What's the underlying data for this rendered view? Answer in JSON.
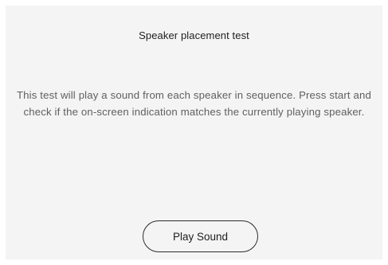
{
  "dialog": {
    "title": "Speaker placement test",
    "description": "This test will play a sound from each speaker in sequence. Press start and check if the on-screen indication matches the currently playing speaker.",
    "play_button_label": "Play Sound"
  }
}
